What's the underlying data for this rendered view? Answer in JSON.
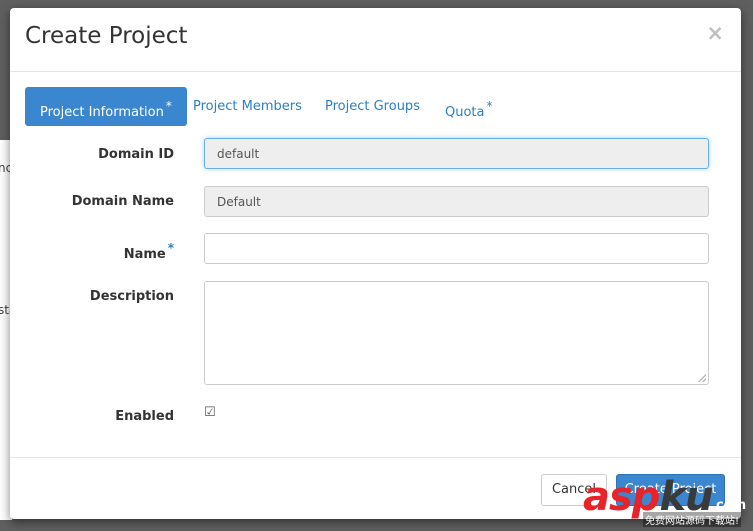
{
  "backdrop": {
    "fragment_1": "nc",
    "fragment_2": "sta"
  },
  "modal": {
    "title": "Create Project",
    "close_glyph": "×"
  },
  "tabs": [
    {
      "label": "Project Information",
      "required": "*",
      "active": true
    },
    {
      "label": "Project Members",
      "required": "",
      "active": false
    },
    {
      "label": "Project Groups",
      "required": "",
      "active": false
    },
    {
      "label": "Quota",
      "required": "*",
      "active": false
    }
  ],
  "form": {
    "domain_id": {
      "label": "Domain ID",
      "value": "default"
    },
    "domain_name": {
      "label": "Domain Name",
      "value": "Default"
    },
    "name": {
      "label": "Name",
      "required": "*",
      "value": ""
    },
    "description": {
      "label": "Description",
      "value": ""
    },
    "enabled": {
      "label": "Enabled",
      "checked": true,
      "glyph": "☑"
    }
  },
  "footer": {
    "cancel_label": "Cancel",
    "create_label": "Create Project"
  },
  "watermark": {
    "text": "asp",
    "text_k": "ku",
    "suffix": ".com",
    "subtitle": "免费网站源码下载站!"
  },
  "colors": {
    "primary": "#3b87cf",
    "link": "#2a7fc6",
    "readonly_bg": "#eeeeee",
    "focus": "#66afe9"
  }
}
